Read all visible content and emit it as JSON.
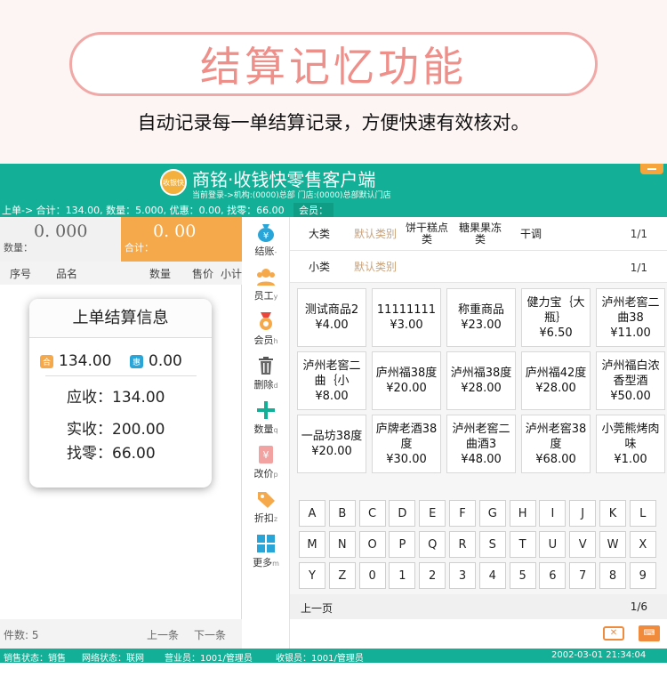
{
  "promo": {
    "title": "结算记忆功能",
    "subtitle": "自动记录每一单结算记录，方便快速有效核对。"
  },
  "app": {
    "logo_text": "收银快",
    "title": "商铭·收钱快零售客户端",
    "login_info": "当前登录->机构:(0000)总部 门店:(0000)总部默认门店",
    "last_order_line": "上单-> 合计：134.00, 数量：5.000, 优惠：0.00, 找零：66.00",
    "member_label": "会员："
  },
  "left": {
    "qty_value": "0. 000",
    "qty_label": "数量：",
    "total_value": "0. 00",
    "total_label": "合计：",
    "columns": [
      "序号",
      "品名",
      "数量",
      "售价",
      "小计"
    ],
    "card": {
      "title": "上单结算信息",
      "he_badge": "合",
      "total": "134.00",
      "hui_badge": "惠",
      "discount": "0.00",
      "receivable": "应收：134.00",
      "received": "实收：200.00",
      "change": "找零：66.00"
    },
    "item_count": "件数:  5",
    "prev": "上一条",
    "next": "下一条"
  },
  "toolbar": [
    {
      "label": "结账",
      "key": "-",
      "icon": "money-bag-icon"
    },
    {
      "label": "员工",
      "key": "y",
      "icon": "staff-icon"
    },
    {
      "label": "会员",
      "key": "h",
      "icon": "member-medal-icon"
    },
    {
      "label": "删除",
      "key": "d",
      "icon": "trash-icon"
    },
    {
      "label": "数量",
      "key": "q",
      "icon": "plus-icon"
    },
    {
      "label": "改价",
      "key": "p",
      "icon": "price-edit-icon"
    },
    {
      "label": "折扣",
      "key": "z",
      "icon": "discount-tag-icon"
    },
    {
      "label": "更多",
      "key": "m",
      "icon": "more-grid-icon"
    }
  ],
  "categories": {
    "major_label": "大类",
    "major": [
      "默认类别",
      "饼干糕点类",
      "糖果果冻类",
      "干调"
    ],
    "major_page": "1/1",
    "minor_label": "小类",
    "minor": [
      "默认类别"
    ],
    "minor_page": "1/1"
  },
  "products": [
    {
      "name": "测试商品2",
      "price": "¥4.00"
    },
    {
      "name": "11111111",
      "price": "¥3.00"
    },
    {
      "name": "称重商品",
      "price": "¥23.00"
    },
    {
      "name": "健力宝｛大瓶｝",
      "price": "¥6.50"
    },
    {
      "name": "泸州老窖二曲38",
      "price": "¥11.00"
    },
    {
      "name": "泸州老窖二曲｛小",
      "price": "¥8.00"
    },
    {
      "name": "庐州福38度",
      "price": "¥20.00"
    },
    {
      "name": "泸州福38度",
      "price": "¥28.00"
    },
    {
      "name": "庐州福42度",
      "price": "¥28.00"
    },
    {
      "name": "泸州福白浓香型酒",
      "price": "¥50.00"
    },
    {
      "name": "一品坊38度",
      "price": "¥20.00"
    },
    {
      "name": "庐牌老酒38度",
      "price": "¥30.00"
    },
    {
      "name": "泸州老窖二曲酒3",
      "price": "¥48.00"
    },
    {
      "name": "泸州老窖38度",
      "price": "¥68.00"
    },
    {
      "name": "小莞熊烤肉味",
      "price": "¥1.00"
    }
  ],
  "keys": [
    [
      "A",
      "B",
      "C",
      "D",
      "E",
      "F",
      "G",
      "H",
      "I",
      "J",
      "K",
      "L"
    ],
    [
      "M",
      "N",
      "O",
      "P",
      "Q",
      "R",
      "S",
      "T",
      "U",
      "V",
      "W",
      "X"
    ],
    [
      "Y",
      "Z",
      "0",
      "1",
      "2",
      "3",
      "4",
      "5",
      "6",
      "7",
      "8",
      "9"
    ]
  ],
  "pager": {
    "prev": "上一页",
    "page": "1/6"
  },
  "status": {
    "sale": "销售状态：销售",
    "network": "网络状态：联网",
    "clerk": "营业员：1001/管理员",
    "cashier": "收银员：1001/管理员",
    "time": "2002-03-01 21:34:04"
  },
  "colors": {
    "brand": "#13b097",
    "accent": "#f6a94a",
    "promo": "#ef8f8a"
  }
}
